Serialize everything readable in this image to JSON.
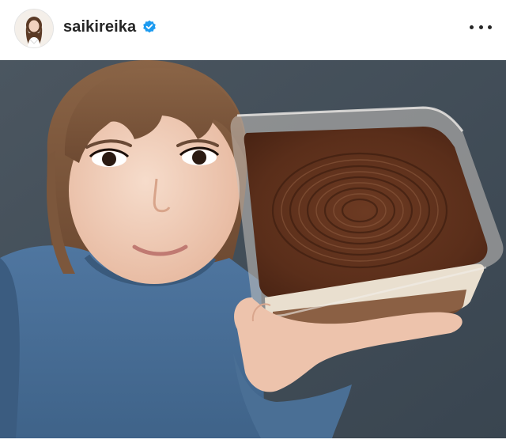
{
  "post": {
    "username": "saikireika",
    "verified": true,
    "icons": {
      "verified": "verified-badge-icon",
      "more": "more-options-icon"
    },
    "colors": {
      "verified_badge": "#1d9bf0",
      "text": "#262626",
      "photo_background": "#3f4b56",
      "sweater": "#4a6f95",
      "tiramisu_cocoa": "#6a3a22"
    }
  }
}
